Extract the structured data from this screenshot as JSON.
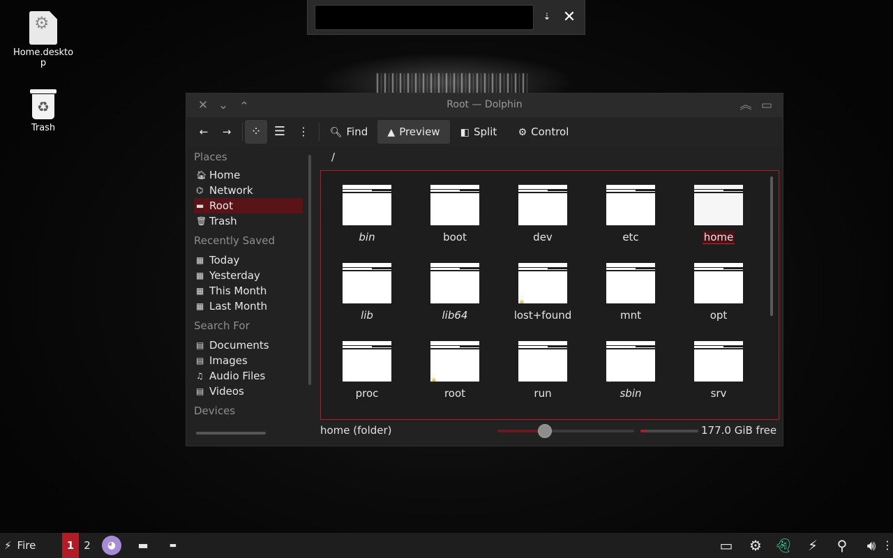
{
  "desktop": {
    "icons": [
      {
        "label": "Home.desktop"
      },
      {
        "label": "Trash"
      }
    ]
  },
  "search": {
    "value": "",
    "placeholder": ""
  },
  "window": {
    "title": "Root — Dolphin",
    "toolbar": {
      "find": "Find",
      "preview": "Preview",
      "split": "Split",
      "control": "Control"
    },
    "places": {
      "sections": [
        {
          "title": "Places",
          "items": [
            {
              "label": "Home"
            },
            {
              "label": "Network"
            },
            {
              "label": "Root"
            },
            {
              "label": "Trash"
            }
          ]
        },
        {
          "title": "Recently Saved",
          "items": [
            {
              "label": "Today"
            },
            {
              "label": "Yesterday"
            },
            {
              "label": "This Month"
            },
            {
              "label": "Last Month"
            }
          ]
        },
        {
          "title": "Search For",
          "items": [
            {
              "label": "Documents"
            },
            {
              "label": "Images"
            },
            {
              "label": "Audio Files"
            },
            {
              "label": "Videos"
            }
          ]
        },
        {
          "title": "Devices",
          "items": []
        }
      ],
      "selected": "Root"
    },
    "location": "/",
    "files": [
      {
        "name": "bin",
        "symlink": true
      },
      {
        "name": "boot"
      },
      {
        "name": "dev"
      },
      {
        "name": "etc"
      },
      {
        "name": "home",
        "selected": true
      },
      {
        "name": "lib",
        "symlink": true
      },
      {
        "name": "lib64",
        "symlink": true
      },
      {
        "name": "lost+found",
        "locked": true
      },
      {
        "name": "mnt"
      },
      {
        "name": "opt"
      },
      {
        "name": "proc"
      },
      {
        "name": "root",
        "locked": true
      },
      {
        "name": "run"
      },
      {
        "name": "sbin",
        "symlink": true
      },
      {
        "name": "srv"
      }
    ],
    "status": {
      "selection": "home (folder)",
      "zoom_fraction": 0.33,
      "used_fraction": 0.1,
      "free_space": "177.0 GiB free"
    }
  },
  "taskbar": {
    "start_label": "Fire",
    "desktops": [
      "1",
      "2"
    ],
    "active_desktop": "1"
  },
  "colors": {
    "accent": "#b21c24",
    "selection_bg": "#5a1418",
    "window_bg": "#222222",
    "titlebar_bg": "#2b2b2b"
  }
}
